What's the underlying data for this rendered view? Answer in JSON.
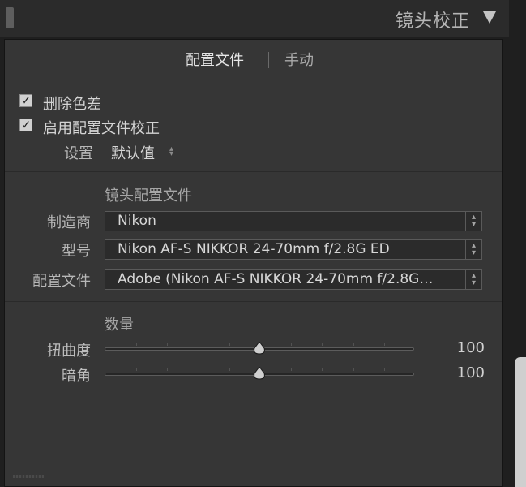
{
  "panel": {
    "title": "镜头校正"
  },
  "tabs": [
    {
      "label": "配置文件",
      "active": true
    },
    {
      "label": "手动",
      "active": false
    }
  ],
  "options": {
    "remove_ca": {
      "label": "删除色差",
      "checked": true
    },
    "enable_profile": {
      "label": "启用配置文件校正",
      "checked": true
    },
    "setup": {
      "label": "设置",
      "value": "默认值"
    }
  },
  "lens_profile": {
    "heading": "镜头配置文件",
    "make": {
      "label": "制造商",
      "value": "Nikon"
    },
    "model": {
      "label": "型号",
      "value": "Nikon AF-S NIKKOR 24-70mm f/2.8G ED"
    },
    "profile": {
      "label": "配置文件",
      "value": "Adobe (Nikon AF-S NIKKOR 24-70mm f/2.8G…"
    }
  },
  "amount": {
    "heading": "数量",
    "distortion": {
      "label": "扭曲度",
      "value": "100",
      "fraction": 0.5
    },
    "vignetting": {
      "label": "暗角",
      "value": "100",
      "fraction": 0.5
    }
  },
  "colors": {
    "panel_bg": "#363636",
    "header_bg": "#2b2b2b",
    "text": "#d4d4d4",
    "scrollbar": "#cfcfcf"
  }
}
